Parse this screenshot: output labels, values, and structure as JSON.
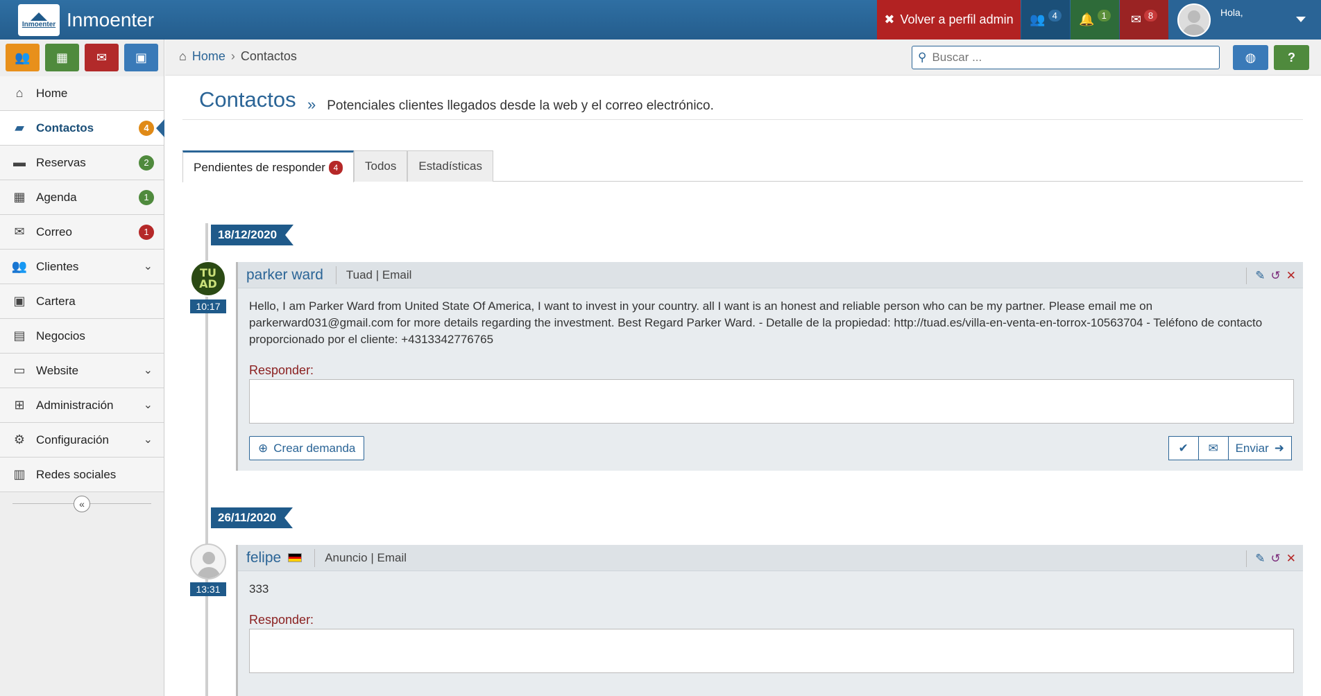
{
  "app": {
    "logo_text": "Inmoenter",
    "name": "Inmoenter"
  },
  "topbar": {
    "admin_label": "Volver a perfil admin",
    "users_count": "4",
    "notifications_count": "1",
    "mail_count": "8",
    "greeting": "Hola,"
  },
  "quick_buttons": [
    "users-icon",
    "calendar-icon",
    "mail-icon",
    "briefcase-icon"
  ],
  "sidebar": {
    "items": [
      {
        "label": "Home",
        "icon": "home-icon"
      },
      {
        "label": "Contactos",
        "icon": "chat-icon",
        "badge": "4"
      },
      {
        "label": "Reservas",
        "icon": "bed-icon",
        "badge": "2"
      },
      {
        "label": "Agenda",
        "icon": "calendar-icon",
        "badge": "1"
      },
      {
        "label": "Correo",
        "icon": "envelope-icon",
        "badge": "1"
      },
      {
        "label": "Clientes",
        "icon": "users-icon"
      },
      {
        "label": "Cartera",
        "icon": "briefcase-icon"
      },
      {
        "label": "Negocios",
        "icon": "money-icon"
      },
      {
        "label": "Website",
        "icon": "monitor-icon"
      },
      {
        "label": "Administración",
        "icon": "sitemap-icon"
      },
      {
        "label": "Configuración",
        "icon": "gears-icon"
      },
      {
        "label": "Redes sociales",
        "icon": "map-icon"
      }
    ]
  },
  "breadcrumb": {
    "home": "Home",
    "current": "Contactos"
  },
  "search": {
    "placeholder": "Buscar ..."
  },
  "page": {
    "title": "Contactos",
    "subtitle": "Potenciales clientes llegados desde la web y el correo electrónico."
  },
  "tabs": [
    {
      "label": "Pendientes de responder",
      "badge": "4"
    },
    {
      "label": "Todos"
    },
    {
      "label": "Estadísticas"
    }
  ],
  "contacts": [
    {
      "date": "18/12/2020",
      "time": "10:17",
      "avatar_text_1": "TU",
      "avatar_text_2": "AD",
      "name": "parker ward",
      "source": "Tuad | Email",
      "message": "Hello, I am Parker Ward from United State Of America, I want to invest in your country. all I want is an honest and reliable person who can be my partner. Please email me on parkerward031@gmail.com for more details regarding the investment. Best Regard Parker Ward. - Detalle de la propiedad: http://tuad.es/villa-en-venta-en-torrox-10563704 - Teléfono de contacto proporcionado por el cliente: +4313342776765",
      "reply_label": "Responder:",
      "crear_label": "Crear demanda",
      "send_label": "Enviar"
    },
    {
      "date": "26/11/2020",
      "time": "13:31",
      "name": "felipe",
      "flag": "germany",
      "source": "Anuncio | Email",
      "message": "333",
      "reply_label": "Responder:"
    }
  ],
  "colors": {
    "primary": "#2a6496",
    "danger": "#b22222",
    "success": "#4f8a3d",
    "warning": "#e8901b"
  }
}
